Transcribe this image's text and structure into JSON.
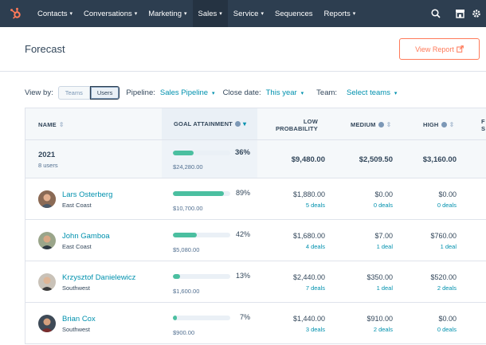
{
  "nav": {
    "items": [
      {
        "label": "Contacts",
        "caret": true
      },
      {
        "label": "Conversations",
        "caret": true
      },
      {
        "label": "Marketing",
        "caret": true
      },
      {
        "label": "Sales",
        "caret": true,
        "active": true
      },
      {
        "label": "Service",
        "caret": true
      },
      {
        "label": "Sequences",
        "caret": false
      },
      {
        "label": "Reports",
        "caret": true
      }
    ],
    "icons": [
      "search-icon",
      "marketplace-icon",
      "settings-icon"
    ]
  },
  "header": {
    "title": "Forecast",
    "view_report_label": "View Report"
  },
  "filters": {
    "view_by_label": "View by:",
    "view_by_options": [
      "Teams",
      "Users"
    ],
    "view_by_selected": "Users",
    "pipeline_label": "Pipeline:",
    "pipeline_value": "Sales Pipeline",
    "close_date_label": "Close date:",
    "close_date_value": "This year",
    "team_label": "Team:",
    "team_value": "Select teams"
  },
  "table": {
    "columns": {
      "name": "NAME",
      "goal": "GOAL ATTAINMENT",
      "low_line1": "LOW",
      "low_line2": "PROBABILITY",
      "medium": "MEDIUM",
      "high": "HIGH",
      "forecast_line1": "F",
      "forecast_line2": "S"
    },
    "total": {
      "year": "2021",
      "users": "8 users",
      "percent": "36%",
      "fraction": 0.36,
      "amount": "$24,280.00",
      "low": "$9,480.00",
      "medium": "$2,509.50",
      "high": "$3,160.00"
    },
    "rows": [
      {
        "name": "Lars Osterberg",
        "team": "East Coast",
        "percent": "89%",
        "fraction": 0.89,
        "amount": "$10,700.00",
        "low": "$1,880.00",
        "low_deals": "5 deals",
        "medium": "$0.00",
        "medium_deals": "0 deals",
        "high": "$0.00",
        "high_deals": "0 deals"
      },
      {
        "name": "John Gamboa",
        "team": "East Coast",
        "percent": "42%",
        "fraction": 0.42,
        "amount": "$5,080.00",
        "low": "$1,680.00",
        "low_deals": "4 deals",
        "medium": "$7.00",
        "medium_deals": "1 deal",
        "high": "$760.00",
        "high_deals": "1 deal"
      },
      {
        "name": "Krzysztof Danielewicz",
        "team": "Southwest",
        "percent": "13%",
        "fraction": 0.13,
        "amount": "$1,600.00",
        "low": "$2,440.00",
        "low_deals": "7 deals",
        "medium": "$350.00",
        "medium_deals": "1 deal",
        "high": "$520.00",
        "high_deals": "2 deals"
      },
      {
        "name": "Brian Cox",
        "team": "Southwest",
        "percent": "7%",
        "fraction": 0.07,
        "amount": "$900.00",
        "low": "$1,440.00",
        "low_deals": "3 deals",
        "medium": "$910.00",
        "medium_deals": "2 deals",
        "high": "$0.00",
        "high_deals": "0 deals"
      }
    ]
  },
  "colors": {
    "nav_bg": "#2d3e50",
    "accent_orange": "#ff7a59",
    "link_teal": "#0091ae",
    "bar_green": "#4bbfa0"
  }
}
